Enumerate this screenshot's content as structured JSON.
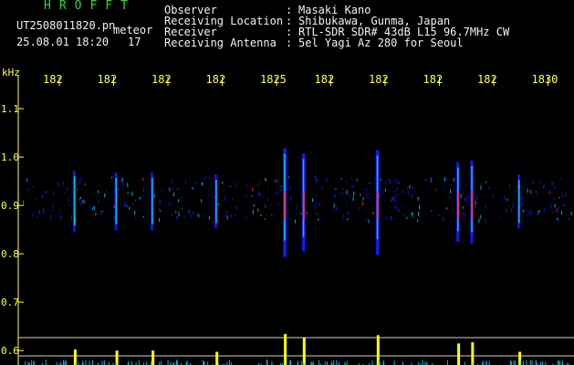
{
  "header": {
    "brand": "HROFFT",
    "filename": "UT2508011820.pn",
    "label": "meteor",
    "datetime": "25.08.01 18:20",
    "count": "17",
    "fields": [
      {
        "key": "Observer",
        "sep": ":",
        "value": "Masaki Kano"
      },
      {
        "key": "Receiving Location",
        "sep": ":",
        "value": "Shibukawa, Gunma, Japan"
      },
      {
        "key": "Receiver",
        "sep": ":",
        "value": "RTL-SDR SDR# 43dB L15 96.7MHz CW"
      },
      {
        "key": "Receiving Antenna",
        "sep": ":",
        "value": "5el Yagi Az 280 for Seoul"
      }
    ]
  },
  "colors": {
    "text_header": "#f2f2f2",
    "brand": "#3ccf3c",
    "axis": "#ffff40",
    "spectrum_low": "#1a1aff",
    "spectrum_mid": "#00e0ff",
    "spectrum_high": "#ff3030",
    "echo_bar": "#ffff00"
  },
  "chart_data": {
    "type": "heatmap",
    "title": "",
    "ylabel": "kHz",
    "xlabel": "",
    "x_tick_labels": [
      "182",
      "182",
      "182",
      "182",
      "182",
      "182",
      "182",
      "182",
      "182",
      "1830"
    ],
    "x_tick_suffixes": [
      "",
      "",
      "",
      "",
      "5",
      "",
      "",
      "",
      "",
      ""
    ],
    "yticks": [
      1.1,
      1.0,
      0.9,
      0.8,
      0.7,
      0.6
    ],
    "ylim": [
      0.57,
      1.17
    ],
    "grid": false,
    "signal_band_khz": [
      0.87,
      0.96
    ],
    "meteor_events": [
      {
        "x_fraction": 0.1,
        "intensity": 0.35
      },
      {
        "x_fraction": 0.175,
        "intensity": 0.3
      },
      {
        "x_fraction": 0.24,
        "intensity": 0.3
      },
      {
        "x_fraction": 0.355,
        "intensity": 0.25
      },
      {
        "x_fraction": 0.478,
        "intensity": 1.0
      },
      {
        "x_fraction": 0.512,
        "intensity": 0.85
      },
      {
        "x_fraction": 0.645,
        "intensity": 0.95
      },
      {
        "x_fraction": 0.79,
        "intensity": 0.6
      },
      {
        "x_fraction": 0.815,
        "intensity": 0.65
      },
      {
        "x_fraction": 0.9,
        "intensity": 0.25
      }
    ],
    "echo_counter_lines": [
      0.62,
      0.6
    ]
  }
}
